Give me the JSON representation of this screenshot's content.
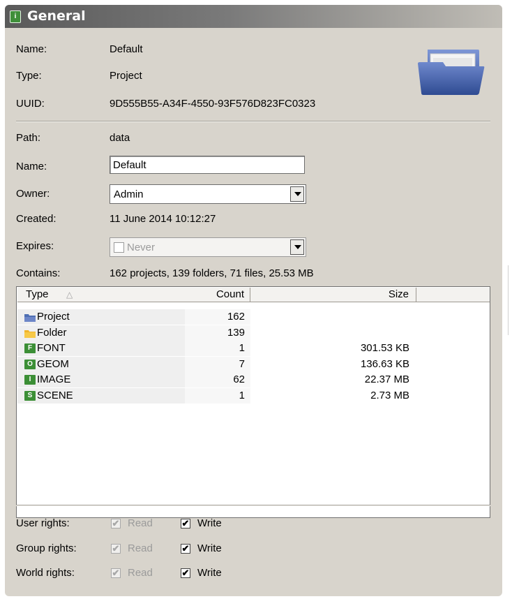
{
  "panel": {
    "title": "General"
  },
  "info": {
    "name_label": "Name:",
    "name_value": "Default",
    "type_label": "Type:",
    "type_value": "Project",
    "uuid_label": "UUID:",
    "uuid_value": "9D555B55-A34F-4550-93F576D823FC0323"
  },
  "details": {
    "path_label": "Path:",
    "path_value": "data",
    "name_label": "Name:",
    "name_input": "Default",
    "owner_label": "Owner:",
    "owner_selected": "Admin",
    "created_label": "Created:",
    "created_value": "11 June 2014 10:12:27",
    "expires_label": "Expires:",
    "expires_selected": "Never",
    "contains_label": "Contains:",
    "contains_value": "162 projects, 139 folders, 71 files, 25.53 MB"
  },
  "table": {
    "columns": [
      "Type",
      "Count",
      "Size"
    ],
    "sort_indicator": "△",
    "rows": [
      {
        "icon": "project-folder-icon",
        "badge": "",
        "type": "Project",
        "count": "162",
        "size": ""
      },
      {
        "icon": "folder-icon",
        "badge": "",
        "type": "Folder",
        "count": "139",
        "size": ""
      },
      {
        "icon": "font-file-icon",
        "badge": "F",
        "type": "FONT",
        "count": "1",
        "size": "301.53 KB"
      },
      {
        "icon": "geom-file-icon",
        "badge": "O",
        "type": "GEOM",
        "count": "7",
        "size": "136.63 KB"
      },
      {
        "icon": "image-file-icon",
        "badge": "I",
        "type": "IMAGE",
        "count": "62",
        "size": "22.37 MB"
      },
      {
        "icon": "scene-file-icon",
        "badge": "S",
        "type": "SCENE",
        "count": "1",
        "size": "2.73 MB"
      }
    ]
  },
  "rights": {
    "user_label": "User rights:",
    "group_label": "Group rights:",
    "world_label": "World rights:",
    "read_label": "Read",
    "write_label": "Write",
    "user_read": true,
    "user_write": true,
    "group_read": true,
    "group_write": true,
    "world_read": true,
    "world_write": true
  },
  "colors": {
    "icon_green": "#3c8f36",
    "folder_blue": "#4f6fb3",
    "folder_yellow": "#f0b429"
  }
}
